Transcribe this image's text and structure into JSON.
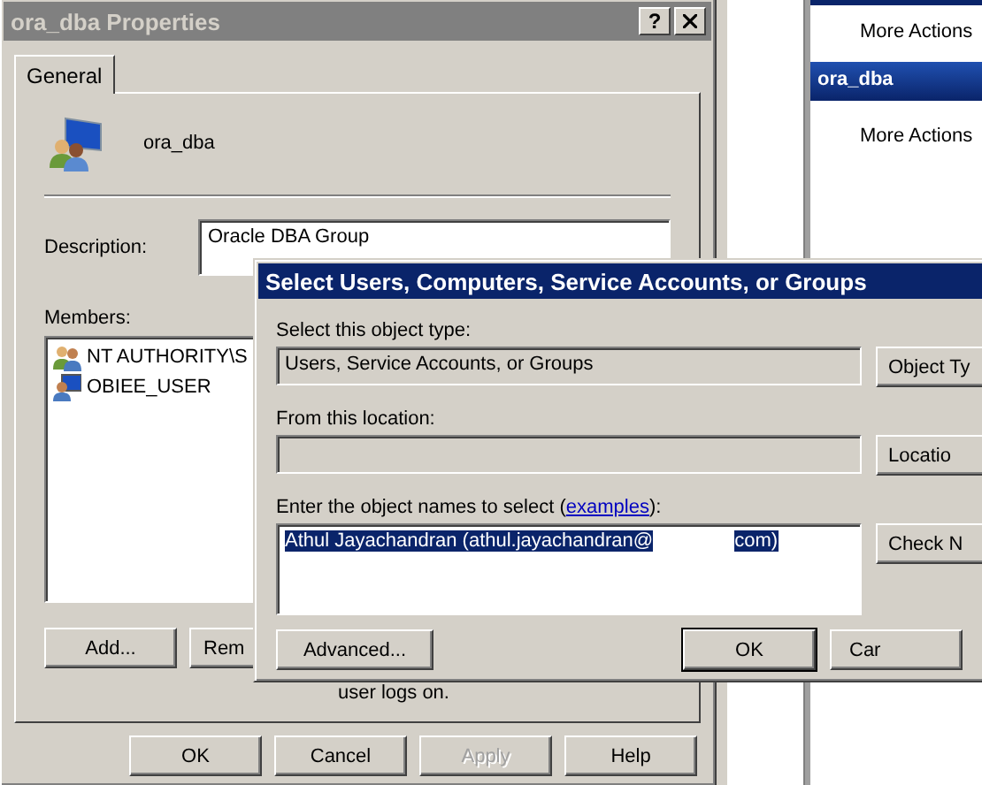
{
  "properties_window": {
    "title": "ora_dba Properties",
    "help_button": "?",
    "tabs": [
      {
        "label": "General",
        "selected": true
      }
    ],
    "group_name": "ora_dba",
    "description_label": "Description:",
    "description_value": "Oracle DBA Group",
    "members_label": "Members:",
    "members": [
      {
        "name": "NT AUTHORITY\\S",
        "kind": "group"
      },
      {
        "name": "OBIEE_USER",
        "kind": "user"
      }
    ],
    "member_buttons": [
      {
        "label": "Add...",
        "disabled": false
      },
      {
        "label": "Rem",
        "disabled": false
      }
    ],
    "note": "user logs on.",
    "dialog_buttons": [
      {
        "label": "OK",
        "disabled": false
      },
      {
        "label": "Cancel",
        "disabled": false
      },
      {
        "label": "Apply",
        "disabled": true
      },
      {
        "label": "Help",
        "disabled": false
      }
    ]
  },
  "actions_pane": {
    "items": [
      {
        "kind": "action",
        "label": "More Actions"
      },
      {
        "kind": "header",
        "label": "ora_dba"
      },
      {
        "kind": "action",
        "label": "More Actions"
      }
    ]
  },
  "select_dialog": {
    "title": "Select Users, Computers, Service Accounts, or Groups",
    "object_type_label": "Select this object type:",
    "object_type_value": "Users, Service Accounts, or Groups",
    "object_type_button": "Object Ty",
    "location_label": "From this location:",
    "location_button": "Locatio",
    "names_label": "Enter the object names to select (",
    "names_link": "examples",
    "names_label_end": "):",
    "names_value_start": "Athul Jayachandran (athul.jayachandran@",
    "names_value_end": "com)",
    "names_selected": true,
    "check_button": "Check N",
    "advanced_button": "Advanced...",
    "buttons": [
      {
        "label": "OK",
        "default": true
      },
      {
        "label": "Car",
        "default": false
      }
    ]
  }
}
